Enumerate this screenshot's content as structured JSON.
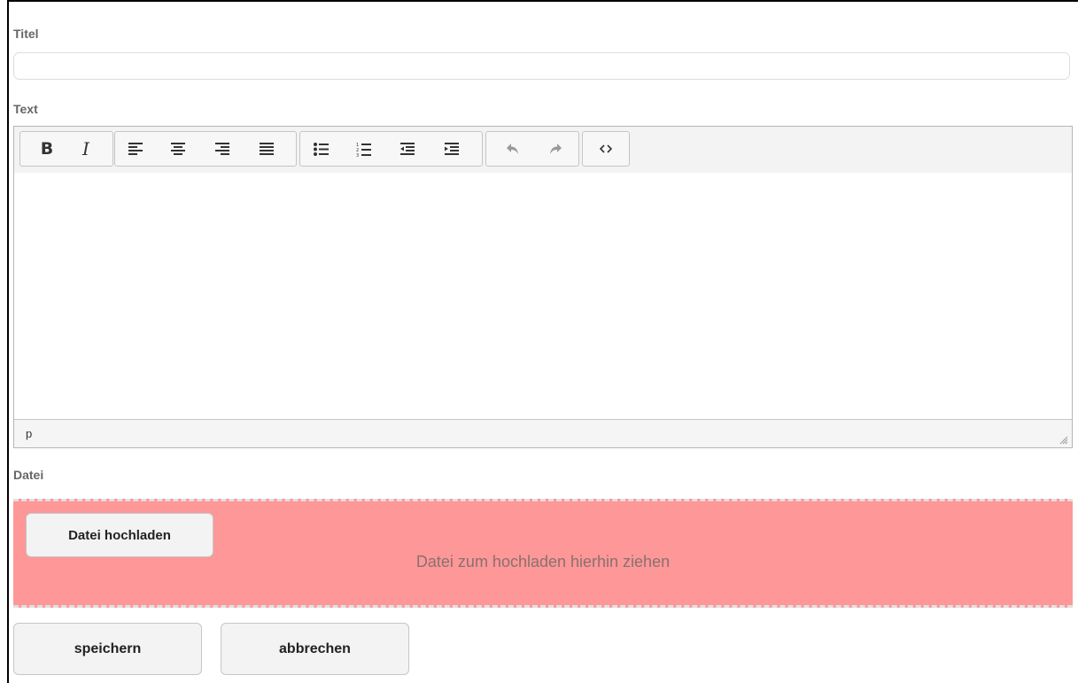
{
  "form": {
    "title_label": "Titel",
    "title_value": "",
    "text_label": "Text",
    "file_label": "Datei"
  },
  "editor": {
    "toolbar": {
      "bold": "B",
      "italic": "I"
    },
    "statusbar_path": "p"
  },
  "upload": {
    "button_label": "Datei hochladen",
    "drop_hint": "Datei zum hochladen hierhin ziehen"
  },
  "actions": {
    "save_label": "speichern",
    "cancel_label": "abbrechen"
  },
  "colors": {
    "dropzone_background": "#fe9797",
    "label": "#666666",
    "toolbar_background": "#f3f3f3"
  },
  "icons": [
    "bold-icon",
    "italic-icon",
    "align-left-icon",
    "align-center-icon",
    "align-right-icon",
    "align-justify-icon",
    "bullet-list-icon",
    "numbered-list-icon",
    "outdent-icon",
    "indent-icon",
    "undo-icon",
    "redo-icon",
    "source-code-icon",
    "resize-handle-icon"
  ]
}
